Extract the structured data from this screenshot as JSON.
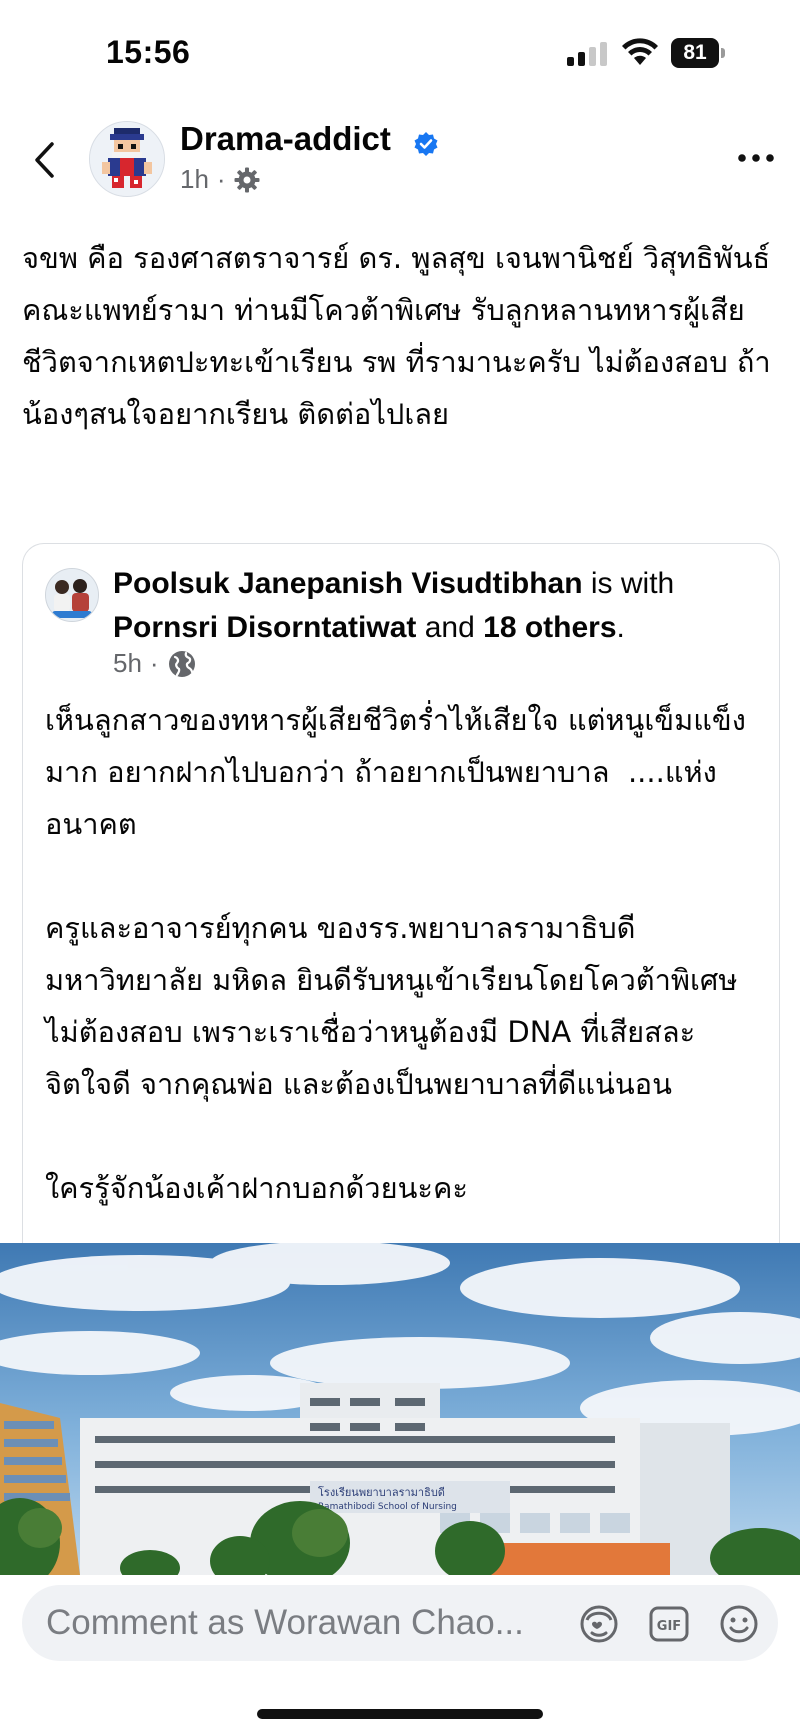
{
  "status": {
    "time": "15:56",
    "battery": "81"
  },
  "post": {
    "author": "Drama-addict",
    "time": "1h",
    "separator": "·",
    "text": "จขพ คือ รองศาสตราจารย์ ดร. พูลสุข เจนพานิชย์ วิสุทธิพันธ์\nคณะแพทย์รามา ท่านมีโควต้าพิเศษ รับลูกหลานทหารผู้เสียชีวิตจากเหตปะทะเข้าเรียน รพ ที่รามานะครับ ไม่ต้องสอบ ถ้าน้องๆสนใจอยากเรียน ติดต่อไปเลย"
  },
  "shared": {
    "author": "Poolsuk Janepanish Visudtibhan",
    "is_with": "is with",
    "tagged": "Pornsri Disorntatiwat",
    "and": "and",
    "others": "18 others",
    "period": ".",
    "time": "5h",
    "separator": "·",
    "text": "เห็นลูกสาวของทหารผู้เสียชีวิตร่ำไห้เสียใจ แต่หนูเข็มแข็งมาก อยากฝากไปบอกว่า ถ้าอยากเป็นพยาบาล  ....แห่งอนาคต\n\nครูและอาจารย์ทุกคน ของรร.พยาบาลรามาธิบดี มหาวิทยาลัย มหิดล ยินดีรับหนูเข้าเรียนโดยโควต้าพิเศษ ไม่ต้องสอบ เพราะเราเชื่อว่าหนูต้องมี DNA ที่เสียสละ จิตใจดี จากคุณพ่อ และต้องเป็นพยาบาลที่ดีแน่นอน\n\nใครรู้จักน้องเค้าฝากบอกด้วยนะคะ"
  },
  "photo": {
    "sign": "โรงเรียนพยาบาลรามาธิบดี",
    "sign_en": "Ramathibodi School of Nursing"
  },
  "comment": {
    "placeholder": "Comment as Worawan Chao..."
  },
  "icons": [
    "back-icon",
    "verified-icon",
    "gear-icon",
    "more-icon",
    "globe-icon",
    "avatar-sticker-icon",
    "gif-icon",
    "emoji-icon"
  ],
  "colors": {
    "verified": "#1877f2",
    "secondary_text": "#65676b",
    "comment_bg": "#f0f2f5"
  }
}
